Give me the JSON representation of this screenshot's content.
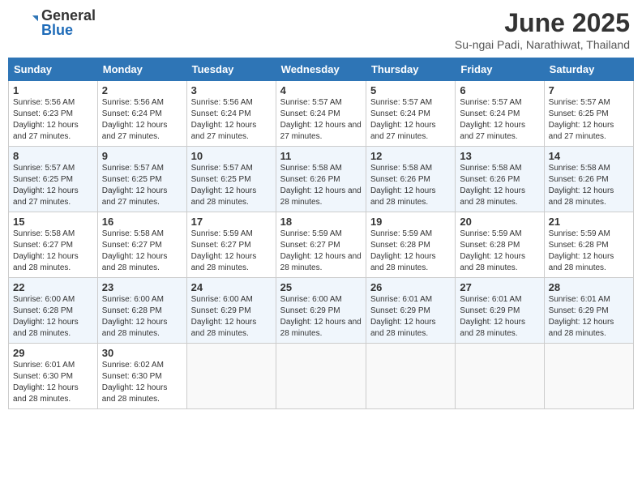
{
  "header": {
    "logo_general": "General",
    "logo_blue": "Blue",
    "month_title": "June 2025",
    "location": "Su-ngai Padi, Narathiwat, Thailand"
  },
  "days_of_week": [
    "Sunday",
    "Monday",
    "Tuesday",
    "Wednesday",
    "Thursday",
    "Friday",
    "Saturday"
  ],
  "weeks": [
    [
      {
        "day": "1",
        "sunrise": "5:56 AM",
        "sunset": "6:23 PM",
        "daylight": "12 hours and 27 minutes."
      },
      {
        "day": "2",
        "sunrise": "5:56 AM",
        "sunset": "6:24 PM",
        "daylight": "12 hours and 27 minutes."
      },
      {
        "day": "3",
        "sunrise": "5:56 AM",
        "sunset": "6:24 PM",
        "daylight": "12 hours and 27 minutes."
      },
      {
        "day": "4",
        "sunrise": "5:57 AM",
        "sunset": "6:24 PM",
        "daylight": "12 hours and 27 minutes."
      },
      {
        "day": "5",
        "sunrise": "5:57 AM",
        "sunset": "6:24 PM",
        "daylight": "12 hours and 27 minutes."
      },
      {
        "day": "6",
        "sunrise": "5:57 AM",
        "sunset": "6:24 PM",
        "daylight": "12 hours and 27 minutes."
      },
      {
        "day": "7",
        "sunrise": "5:57 AM",
        "sunset": "6:25 PM",
        "daylight": "12 hours and 27 minutes."
      }
    ],
    [
      {
        "day": "8",
        "sunrise": "5:57 AM",
        "sunset": "6:25 PM",
        "daylight": "12 hours and 27 minutes."
      },
      {
        "day": "9",
        "sunrise": "5:57 AM",
        "sunset": "6:25 PM",
        "daylight": "12 hours and 27 minutes."
      },
      {
        "day": "10",
        "sunrise": "5:57 AM",
        "sunset": "6:25 PM",
        "daylight": "12 hours and 28 minutes."
      },
      {
        "day": "11",
        "sunrise": "5:58 AM",
        "sunset": "6:26 PM",
        "daylight": "12 hours and 28 minutes."
      },
      {
        "day": "12",
        "sunrise": "5:58 AM",
        "sunset": "6:26 PM",
        "daylight": "12 hours and 28 minutes."
      },
      {
        "day": "13",
        "sunrise": "5:58 AM",
        "sunset": "6:26 PM",
        "daylight": "12 hours and 28 minutes."
      },
      {
        "day": "14",
        "sunrise": "5:58 AM",
        "sunset": "6:26 PM",
        "daylight": "12 hours and 28 minutes."
      }
    ],
    [
      {
        "day": "15",
        "sunrise": "5:58 AM",
        "sunset": "6:27 PM",
        "daylight": "12 hours and 28 minutes."
      },
      {
        "day": "16",
        "sunrise": "5:58 AM",
        "sunset": "6:27 PM",
        "daylight": "12 hours and 28 minutes."
      },
      {
        "day": "17",
        "sunrise": "5:59 AM",
        "sunset": "6:27 PM",
        "daylight": "12 hours and 28 minutes."
      },
      {
        "day": "18",
        "sunrise": "5:59 AM",
        "sunset": "6:27 PM",
        "daylight": "12 hours and 28 minutes."
      },
      {
        "day": "19",
        "sunrise": "5:59 AM",
        "sunset": "6:28 PM",
        "daylight": "12 hours and 28 minutes."
      },
      {
        "day": "20",
        "sunrise": "5:59 AM",
        "sunset": "6:28 PM",
        "daylight": "12 hours and 28 minutes."
      },
      {
        "day": "21",
        "sunrise": "5:59 AM",
        "sunset": "6:28 PM",
        "daylight": "12 hours and 28 minutes."
      }
    ],
    [
      {
        "day": "22",
        "sunrise": "6:00 AM",
        "sunset": "6:28 PM",
        "daylight": "12 hours and 28 minutes."
      },
      {
        "day": "23",
        "sunrise": "6:00 AM",
        "sunset": "6:28 PM",
        "daylight": "12 hours and 28 minutes."
      },
      {
        "day": "24",
        "sunrise": "6:00 AM",
        "sunset": "6:29 PM",
        "daylight": "12 hours and 28 minutes."
      },
      {
        "day": "25",
        "sunrise": "6:00 AM",
        "sunset": "6:29 PM",
        "daylight": "12 hours and 28 minutes."
      },
      {
        "day": "26",
        "sunrise": "6:01 AM",
        "sunset": "6:29 PM",
        "daylight": "12 hours and 28 minutes."
      },
      {
        "day": "27",
        "sunrise": "6:01 AM",
        "sunset": "6:29 PM",
        "daylight": "12 hours and 28 minutes."
      },
      {
        "day": "28",
        "sunrise": "6:01 AM",
        "sunset": "6:29 PM",
        "daylight": "12 hours and 28 minutes."
      }
    ],
    [
      {
        "day": "29",
        "sunrise": "6:01 AM",
        "sunset": "6:30 PM",
        "daylight": "12 hours and 28 minutes."
      },
      {
        "day": "30",
        "sunrise": "6:02 AM",
        "sunset": "6:30 PM",
        "daylight": "12 hours and 28 minutes."
      },
      null,
      null,
      null,
      null,
      null
    ]
  ]
}
